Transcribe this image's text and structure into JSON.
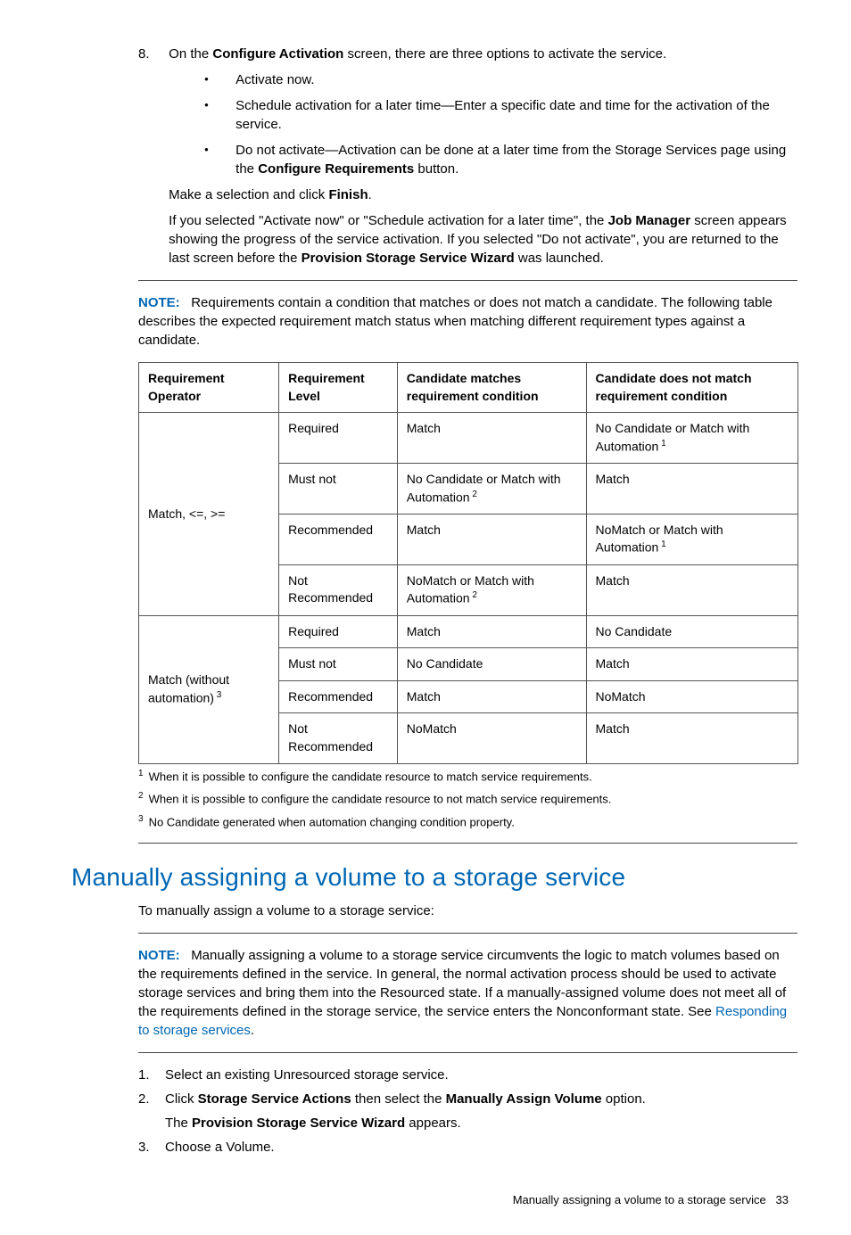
{
  "step8": {
    "num": "8.",
    "intro_a": "On the ",
    "intro_bold": "Configure Activation",
    "intro_b": " screen, there are three options to activate the service.",
    "bullets": {
      "b1": "Activate now.",
      "b2": "Schedule activation for a later time—Enter a specific date and time for the activation of the service.",
      "b3_a": "Do not activate—Activation can be done at a later time from the Storage Services page using the ",
      "b3_bold": "Configure Requirements",
      "b3_b": " button."
    },
    "sub1_a": "Make a selection and click ",
    "sub1_bold": "Finish",
    "sub1_b": ".",
    "sub2_a": "If you selected \"Activate now\" or \"Schedule activation for a later time\", the ",
    "sub2_bold1": "Job Manager",
    "sub2_b": " screen appears showing the progress of the service activation. If you selected \"Do not activate\", you are returned to the last screen before the ",
    "sub2_bold2": "Provision Storage Service Wizard",
    "sub2_c": " was launched."
  },
  "note1": {
    "label": "NOTE:",
    "text": "Requirements contain a condition that matches or does not match a candidate. The following table describes the expected requirement match status when matching different requirement types against a candidate."
  },
  "table": {
    "h1": "Requirement Operator",
    "h2": "Requirement Level",
    "h3": "Candidate matches requirement condition",
    "h4": "Candidate does not match requirement condition",
    "op1": "Match, <=, >=",
    "op2_a": "Match (without automation)",
    "op2_sup": " 3",
    "rows": {
      "r1": {
        "level": "Required",
        "match": "Match",
        "nomatch_a": "No Candidate or Match with Automation",
        "nomatch_sup": " 1"
      },
      "r2": {
        "level": "Must not",
        "match_a": "No Candidate or Match with Automation",
        "match_sup": " 2",
        "nomatch": "Match"
      },
      "r3": {
        "level": "Recommended",
        "match": "Match",
        "nomatch_a": "NoMatch or Match with Automation",
        "nomatch_sup": " 1"
      },
      "r4": {
        "level": "Not Recommended",
        "match_a": "NoMatch or Match with Automation",
        "match_sup": " 2",
        "nomatch": "Match"
      },
      "r5": {
        "level": "Required",
        "match": "Match",
        "nomatch": "No Candidate"
      },
      "r6": {
        "level": "Must not",
        "match": "No Candidate",
        "nomatch": "Match"
      },
      "r7": {
        "level": "Recommended",
        "match": "Match",
        "nomatch": "NoMatch"
      },
      "r8": {
        "level": "Not Recommended",
        "match": "NoMatch",
        "nomatch": "Match"
      }
    }
  },
  "footnotes": {
    "f1n": "1",
    "f1": "When it is possible to configure the candidate resource to match service requirements.",
    "f2n": "2",
    "f2": "When it is possible to configure the candidate resource to not match service requirements.",
    "f3n": "3",
    "f3": "No Candidate generated when automation changing condition property."
  },
  "section": {
    "heading": "Manually assigning a volume to a storage service",
    "intro": "To manually assign a volume to a storage service:"
  },
  "note2": {
    "label": "NOTE:",
    "text_a": "Manually assigning a volume to a storage service circumvents the logic to match volumes based on the requirements defined in the service. In general, the normal activation process should be used to activate storage services and bring them into the Resourced state. If a manually-assigned volume does not meet all of the requirements defined in the storage service, the service enters the Nonconformant state. See ",
    "link": "Responding to storage services",
    "text_b": "."
  },
  "steps2": {
    "s1n": "1.",
    "s1": "Select an existing Unresourced storage service.",
    "s2n": "2.",
    "s2_a": "Click ",
    "s2_b1": "Storage Service Actions",
    "s2_b": " then select the ",
    "s2_b2": "Manually Assign Volume",
    "s2_c": " option.",
    "s2_sub_a": "The ",
    "s2_sub_b": "Provision Storage Service Wizard",
    "s2_sub_c": " appears.",
    "s3n": "3.",
    "s3": "Choose a Volume."
  },
  "footer": {
    "text": "Manually assigning a volume to a storage service",
    "page": "33"
  }
}
